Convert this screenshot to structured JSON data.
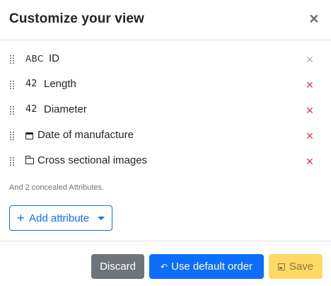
{
  "header": {
    "title": "Customize your view",
    "close_label": "×"
  },
  "attributes": [
    {
      "type_label": "ABC",
      "type_icon": "text-type-icon",
      "name": "ID",
      "remove_label": "×",
      "remove_color": "#adb5bd"
    },
    {
      "type_label": "42",
      "type_icon": "number-type-icon",
      "name": "Length",
      "remove_label": "×",
      "remove_color": "#dc3545"
    },
    {
      "type_label": "42",
      "type_icon": "number-type-icon",
      "name": "Diameter",
      "remove_label": "×",
      "remove_color": "#dc3545"
    },
    {
      "type_label": "",
      "type_icon": "calendar-icon",
      "name": "Date of manufacture",
      "remove_label": "×",
      "remove_color": "#dc3545"
    },
    {
      "type_label": "",
      "type_icon": "folder-icon",
      "name": "Cross sectional images",
      "remove_label": "×",
      "remove_color": "#dc3545"
    }
  ],
  "concealed_note": "And 2 concealed Attributes.",
  "add_attribute": {
    "plus": "+",
    "label": "Add attribute"
  },
  "footer": {
    "discard_label": "Discard",
    "default_order_icon": "↶",
    "default_order_label": "Use default order",
    "save_label": "Save"
  },
  "colors": {
    "primary": "#0d6efd",
    "secondary": "#6c757d",
    "danger": "#dc3545",
    "warning": "#ffd966"
  }
}
